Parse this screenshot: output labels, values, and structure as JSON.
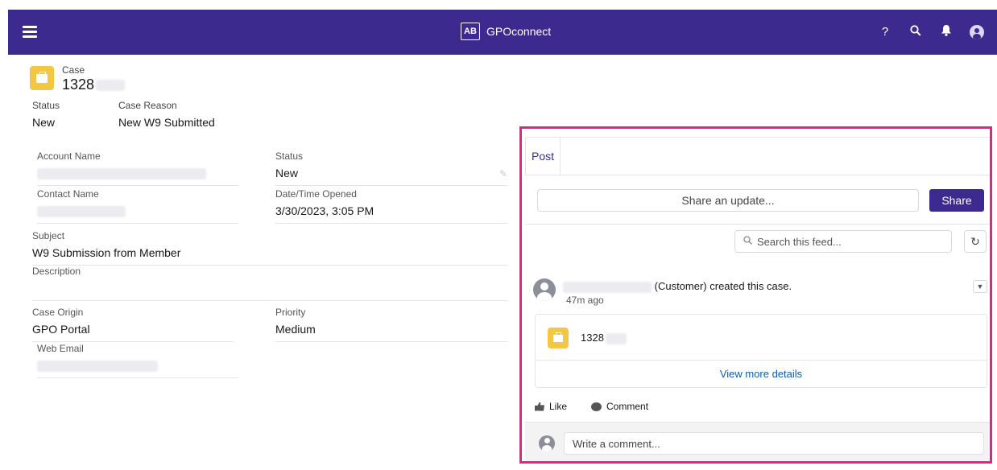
{
  "app": {
    "badge": "AB",
    "name": "GPOconnect"
  },
  "topbar": {
    "help_label": "?",
    "search_icon": "search-icon",
    "bell_icon": "bell-icon",
    "avatar_icon": "user-avatar-icon"
  },
  "case": {
    "object_label": "Case",
    "number": "1328",
    "header": {
      "status_label": "Status",
      "status_value": "New",
      "reason_label": "Case Reason",
      "reason_value": "New W9 Submitted"
    }
  },
  "details": {
    "account_name_label": "Account Name",
    "status_label": "Status",
    "status_value": "New",
    "contact_name_label": "Contact Name",
    "date_opened_label": "Date/Time Opened",
    "date_opened_value": "3/30/2023, 3:05 PM",
    "subject_label": "Subject",
    "subject_value": "W9 Submission from Member",
    "description_label": "Description",
    "description_value": "",
    "origin_label": "Case Origin",
    "origin_value": "GPO Portal",
    "priority_label": "Priority",
    "priority_value": "Medium",
    "web_email_label": "Web Email"
  },
  "feed": {
    "tab_post": "Post",
    "share_placeholder": "Share an update...",
    "share_button": "Share",
    "search_placeholder": "Search this feed...",
    "post": {
      "action_text": "(Customer) created this case.",
      "time": "47m ago",
      "record_number": "1328",
      "view_more": "View more details"
    },
    "like_label": "Like",
    "comment_label": "Comment",
    "comment_placeholder": "Write a comment..."
  },
  "colors": {
    "brand": "#3d2a8f",
    "highlight": "#e6218a",
    "case_icon": "#f2c744",
    "link": "#0b5cab"
  }
}
